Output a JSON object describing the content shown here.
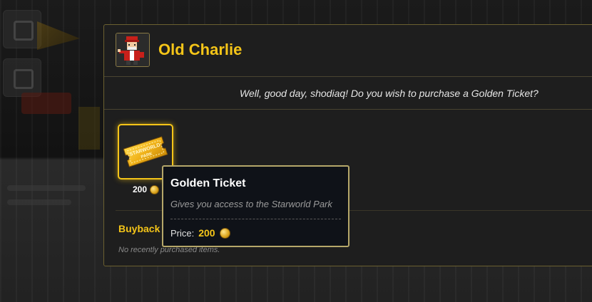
{
  "npc": {
    "name": "Old Charlie",
    "portrait_icon": "old-charlie-portrait"
  },
  "dialogue": {
    "text": "Well, good day, shodiaq! Do you wish to purchase a Golden Ticket?"
  },
  "shop": {
    "items": [
      {
        "name": "Golden Ticket",
        "icon": "golden-ticket-icon",
        "ticket_text": "STARWORLD PARK",
        "price": "200",
        "currency_icon": "gold-coin-icon"
      }
    ]
  },
  "tooltip": {
    "title": "Golden Ticket",
    "description": "Gives you access to the Starworld Park",
    "price_label": "Price:",
    "price_value": "200"
  },
  "buyback": {
    "title": "Buyback",
    "empty_text": "No recently purchased items."
  },
  "colors": {
    "accent_gold": "#f5c518",
    "panel_bg": "#1e1e1e",
    "panel_border": "#6b6030",
    "tooltip_bg": "#0f1218"
  }
}
